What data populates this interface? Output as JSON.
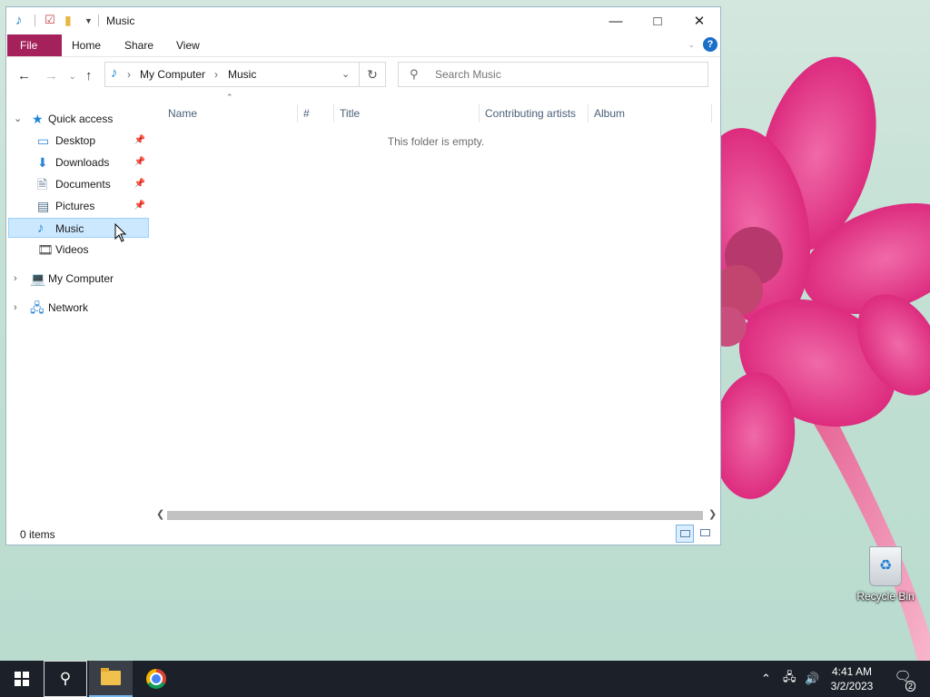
{
  "window": {
    "title": "Music",
    "controls": {
      "minimize": "—",
      "maximize": "□",
      "close": "✕"
    }
  },
  "ribbon": {
    "tabs": [
      {
        "label": "File"
      },
      {
        "label": "Home"
      },
      {
        "label": "Share"
      },
      {
        "label": "View"
      }
    ],
    "help": "?"
  },
  "address": {
    "segments": [
      "My Computer",
      "Music"
    ]
  },
  "search": {
    "placeholder": "Search Music"
  },
  "navpane": {
    "quick_access": "Quick access",
    "items": [
      {
        "label": "Desktop",
        "icon": "desktop-icon",
        "pinned": true
      },
      {
        "label": "Downloads",
        "icon": "downloads-icon",
        "pinned": true
      },
      {
        "label": "Documents",
        "icon": "documents-icon",
        "pinned": true
      },
      {
        "label": "Pictures",
        "icon": "pictures-icon",
        "pinned": true
      },
      {
        "label": "Music",
        "icon": "music-icon",
        "pinned": false,
        "selected": true
      },
      {
        "label": "Videos",
        "icon": "videos-icon",
        "pinned": false
      }
    ],
    "my_computer": "My Computer",
    "network": "Network"
  },
  "columns": [
    "Name",
    "#",
    "Title",
    "Contributing artists",
    "Album"
  ],
  "empty_message": "This folder is empty.",
  "status": {
    "count": "0 items"
  },
  "desktop": {
    "recycle_bin": "Recycle Bin"
  },
  "taskbar": {
    "time": "4:41 AM",
    "date": "3/2/2023",
    "notification_count": "2"
  },
  "colors": {
    "file_tab": "#a4215b",
    "selection": "#cce8ff",
    "taskbar": "#1c2129"
  }
}
